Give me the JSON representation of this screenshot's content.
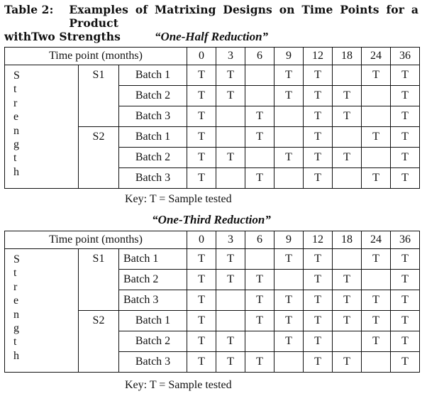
{
  "caption": {
    "label": "Table 2:",
    "text_line1": "Examples of Matrixing Designs on Time Points for a Product",
    "text_line2": "withTwo Strengths"
  },
  "tables": [
    {
      "title": "“One-Half Reduction”",
      "header_label": "Time point (months)",
      "time_points": [
        "0",
        "3",
        "6",
        "9",
        "12",
        "18",
        "24",
        "36"
      ],
      "strength_letters": [
        "S",
        "t",
        "r",
        "e",
        "n",
        "g",
        "t",
        "h"
      ],
      "strengths": [
        {
          "name": "S1",
          "batches": [
            {
              "name": "Batch 1",
              "cells": [
                "T",
                "T",
                "",
                "T",
                "T",
                "",
                "T",
                "T"
              ]
            },
            {
              "name": "Batch 2",
              "cells": [
                "T",
                "T",
                "",
                "T",
                "T",
                "T",
                "",
                "T"
              ]
            },
            {
              "name": "Batch 3",
              "cells": [
                "T",
                "",
                "T",
                "",
                "T",
                "T",
                "",
                "T"
              ]
            }
          ]
        },
        {
          "name": "S2",
          "batches": [
            {
              "name": "Batch 1",
              "cells": [
                "T",
                "",
                "T",
                "",
                "T",
                "",
                "T",
                "T"
              ]
            },
            {
              "name": "Batch 2",
              "cells": [
                "T",
                "T",
                "",
                "T",
                "T",
                "T",
                "",
                "T"
              ]
            },
            {
              "name": "Batch 3",
              "cells": [
                "T",
                "",
                "T",
                "",
                "T",
                "",
                "T",
                "T"
              ]
            }
          ]
        }
      ],
      "key": "Key: T = Sample tested"
    },
    {
      "title": "“One-Third Reduction”",
      "header_label": "Time point (months)",
      "time_points": [
        "0",
        "3",
        "6",
        "9",
        "12",
        "18",
        "24",
        "36"
      ],
      "strength_letters": [
        "S",
        "t",
        "r",
        "e",
        "n",
        "g",
        "t",
        "h"
      ],
      "strengths": [
        {
          "name": "S1",
          "batches": [
            {
              "name": "Batch 1",
              "cells": [
                "T",
                "T",
                "",
                "T",
                "T",
                "",
                "T",
                "T"
              ]
            },
            {
              "name": "Batch 2",
              "cells": [
                "T",
                "T",
                "T",
                "",
                "T",
                "T",
                "",
                "T"
              ]
            },
            {
              "name": "Batch 3",
              "cells": [
                "T",
                "",
                "T",
                "T",
                "T",
                "T",
                "T",
                "T"
              ]
            }
          ]
        },
        {
          "name": "S2",
          "batches": [
            {
              "name": "Batch 1",
              "cells": [
                "T",
                "",
                "T",
                "T",
                "T",
                "T",
                "T",
                "T"
              ]
            },
            {
              "name": "Batch 2",
              "cells": [
                "T",
                "T",
                "",
                "T",
                "T",
                "",
                "T",
                "T"
              ]
            },
            {
              "name": "Batch 3",
              "cells": [
                "T",
                "T",
                "T",
                "",
                "T",
                "T",
                "",
                "T"
              ]
            }
          ]
        }
      ],
      "key": "Key: T = Sample tested"
    }
  ]
}
